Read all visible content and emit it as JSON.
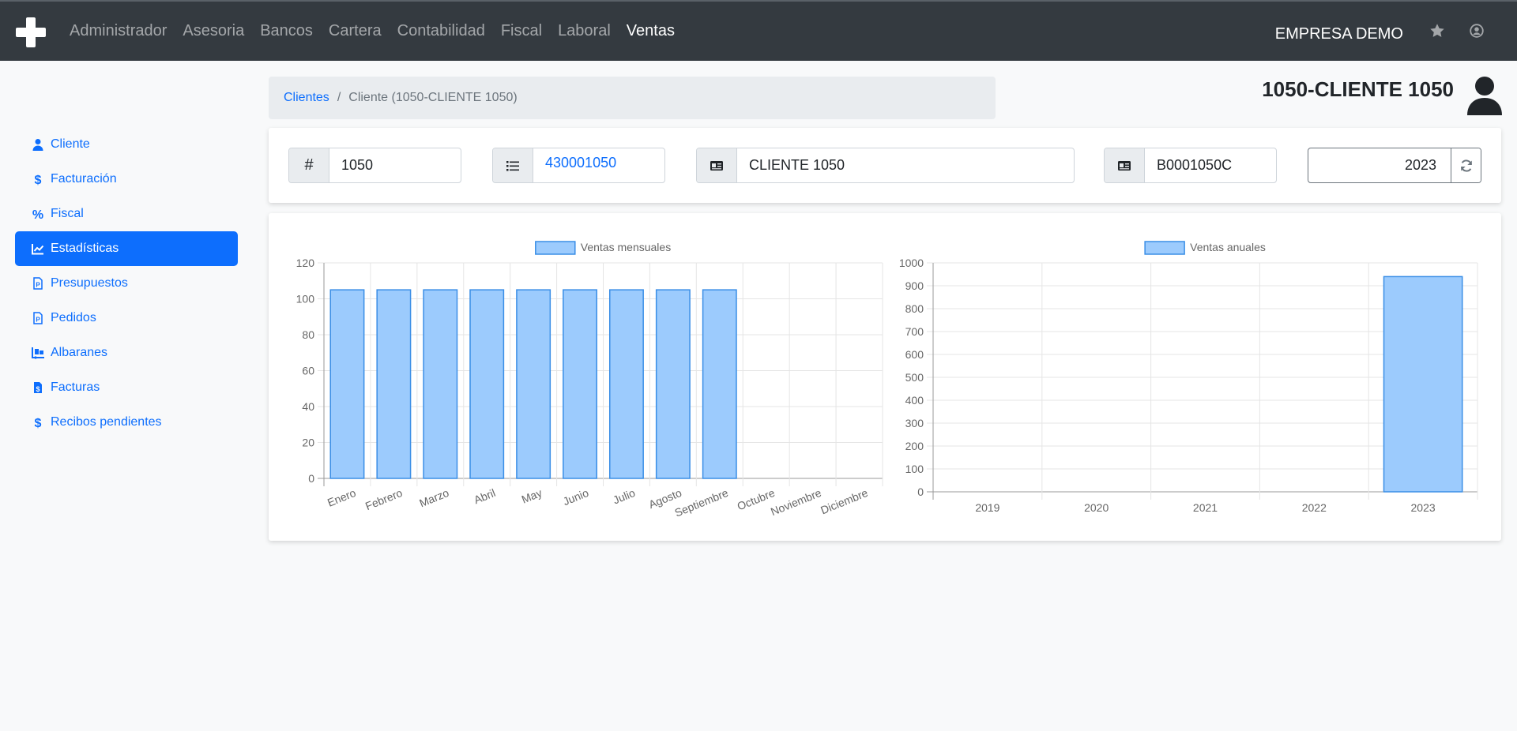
{
  "nav": {
    "items": [
      "Administrador",
      "Asesoria",
      "Bancos",
      "Cartera",
      "Contabilidad",
      "Fiscal",
      "Laboral",
      "Ventas"
    ],
    "active_index": 7,
    "company": "EMPRESA DEMO"
  },
  "breadcrumb": {
    "root": "Clientes",
    "separator": "/",
    "current": "Cliente (1050-CLIENTE 1050)"
  },
  "client": {
    "title": "1050-CLIENTE 1050"
  },
  "sidebar": {
    "items": [
      {
        "label": "Cliente",
        "icon": "user-icon"
      },
      {
        "label": "Facturación",
        "icon": "dollar-icon"
      },
      {
        "label": "Fiscal",
        "icon": "percent-icon"
      },
      {
        "label": "Estadísticas",
        "icon": "chart-line-icon"
      },
      {
        "label": "Presupuestos",
        "icon": "file-p-icon"
      },
      {
        "label": "Pedidos",
        "icon": "file-p-icon"
      },
      {
        "label": "Albaranes",
        "icon": "truck-loading-icon"
      },
      {
        "label": "Facturas",
        "icon": "file-invoice-icon"
      },
      {
        "label": "Recibos pendientes",
        "icon": "dollar-icon"
      }
    ],
    "active_index": 3
  },
  "fields": {
    "code": {
      "addon": "#",
      "value": "1050"
    },
    "account": {
      "value": "430001050"
    },
    "name": {
      "value": "CLIENTE 1050"
    },
    "nif": {
      "value": "B0001050C"
    },
    "year": {
      "value": "2023"
    }
  },
  "colors": {
    "navbar": "#343a40",
    "primary": "#0d6efd",
    "bar_fill": "#9ccbfd",
    "bar_stroke": "#3a8ee6"
  },
  "chart_data": [
    {
      "type": "bar",
      "legend": "Ventas mensuales",
      "categories": [
        "Enero",
        "Febrero",
        "Marzo",
        "Abril",
        "May",
        "Junio",
        "Julio",
        "Agosto",
        "Septiembre",
        "Octubre",
        "Noviembre",
        "Diciembre"
      ],
      "values": [
        105,
        105,
        105,
        105,
        105,
        105,
        105,
        105,
        105,
        0,
        0,
        0
      ],
      "ylim": [
        0,
        120
      ],
      "yticks": [
        0,
        20,
        40,
        60,
        80,
        100,
        120
      ],
      "grid": true,
      "legend_position": "top"
    },
    {
      "type": "bar",
      "legend": "Ventas anuales",
      "categories": [
        "2019",
        "2020",
        "2021",
        "2022",
        "2023"
      ],
      "values": [
        0,
        0,
        0,
        0,
        940
      ],
      "ylim": [
        0,
        1000
      ],
      "yticks": [
        0,
        100,
        200,
        300,
        400,
        500,
        600,
        700,
        800,
        900,
        1000
      ],
      "grid": true,
      "legend_position": "top"
    }
  ]
}
